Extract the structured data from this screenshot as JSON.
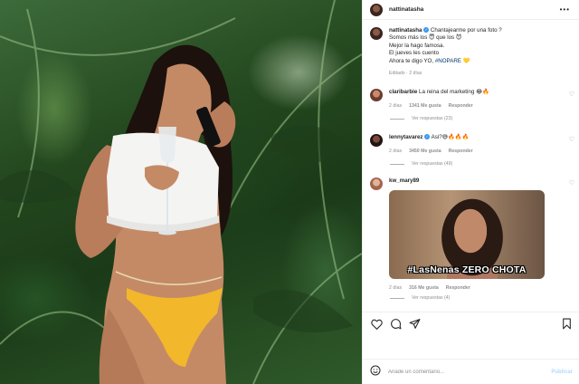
{
  "post": {
    "username": "nattinatasha",
    "caption_lines": [
      "Chantajearme por una foto ?",
      "Somos más los 😇 que los 😈",
      "Mejor la hago famosa.",
      "El jueves les cuento",
      "Ahora te digo YO,"
    ],
    "hashtag": "#NOPARE",
    "caption_end_emoji": "💛",
    "edited": "Editado · 2 días"
  },
  "comments": [
    {
      "username": "claribarbie",
      "text": "La reina del marketing 😂🔥",
      "time": "2 días",
      "likes": "1341 Me gusta",
      "reply": "Responder",
      "view_replies": "Ver respuestas (23)"
    },
    {
      "username": "lennytavarez",
      "text": "Asi?😅🔥🔥🔥",
      "time": "2 días",
      "likes": "3450 Me gusta",
      "reply": "Responder",
      "view_replies": "Ver respuestas (49)"
    },
    {
      "username": "kw_mary89",
      "text": "",
      "gif_caption": "#LasNenas ZERO CHOTA",
      "time": "2 días",
      "likes": "316 Me gusta",
      "reply": "Responder",
      "view_replies": "Ver respuestas (4)"
    }
  ],
  "composer": {
    "placeholder": "Añade un comentario...",
    "publish": "Publicar"
  },
  "icons": {
    "more": "more-options-icon",
    "like": "heart-icon",
    "comment": "comment-icon",
    "share": "share-icon",
    "save": "bookmark-icon",
    "emoji": "emoji-icon"
  },
  "colors": {
    "link": "#00376b",
    "verified": "#3897f0",
    "muted": "#8e8e8e",
    "publish_disabled": "#b3dbff"
  }
}
